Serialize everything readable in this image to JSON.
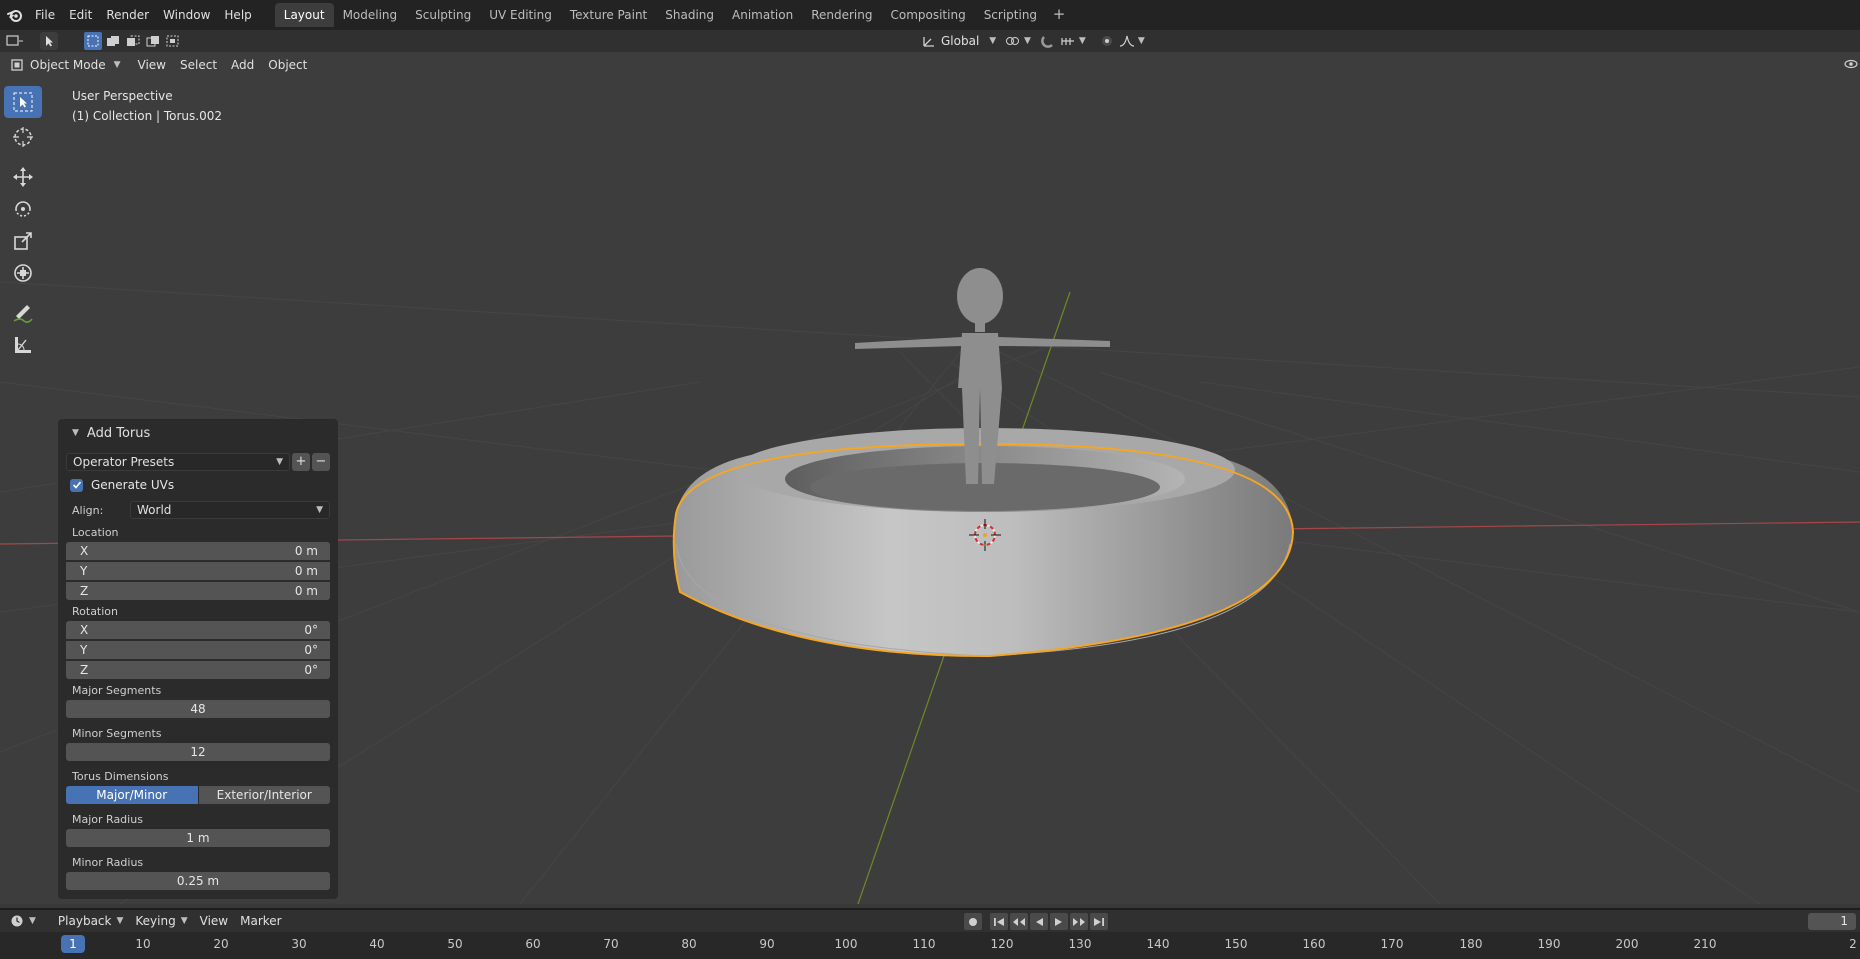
{
  "menubar": {
    "items": [
      "File",
      "Edit",
      "Render",
      "Window",
      "Help"
    ]
  },
  "workspaces": {
    "tabs": [
      "Layout",
      "Modeling",
      "Sculpting",
      "UV Editing",
      "Texture Paint",
      "Shading",
      "Animation",
      "Rendering",
      "Compositing",
      "Scripting"
    ],
    "active": "Layout",
    "add_label": "+"
  },
  "tool_header": {
    "orientation": "Global"
  },
  "viewport_header": {
    "mode": "Object Mode",
    "menus": [
      "View",
      "Select",
      "Add",
      "Object"
    ]
  },
  "viewport": {
    "perspective": "User Perspective",
    "collection_info": "(1) Collection | Torus.002"
  },
  "operator_panel": {
    "title": "Add Torus",
    "presets": "Operator Presets",
    "generate_uvs_label": "Generate UVs",
    "generate_uvs_checked": true,
    "align_label": "Align:",
    "align_value": "World",
    "location_label": "Location",
    "location": [
      {
        "axis": "X",
        "value": "0 m"
      },
      {
        "axis": "Y",
        "value": "0 m"
      },
      {
        "axis": "Z",
        "value": "0 m"
      }
    ],
    "rotation_label": "Rotation",
    "rotation": [
      {
        "axis": "X",
        "value": "0°"
      },
      {
        "axis": "Y",
        "value": "0°"
      },
      {
        "axis": "Z",
        "value": "0°"
      }
    ],
    "major_segments_label": "Major Segments",
    "major_segments": "48",
    "minor_segments_label": "Minor Segments",
    "minor_segments": "12",
    "torus_dimensions_label": "Torus Dimensions",
    "dim_mode_a": "Major/Minor",
    "dim_mode_b": "Exterior/Interior",
    "major_radius_label": "Major Radius",
    "major_radius": "1 m",
    "minor_radius_label": "Minor Radius",
    "minor_radius": "0.25 m"
  },
  "timeline": {
    "menus": [
      "Playback",
      "Keying",
      "View",
      "Marker"
    ],
    "current_frame": "1",
    "frame_field": "1",
    "ticks": [
      "10",
      "20",
      "30",
      "40",
      "50",
      "60",
      "70",
      "80",
      "90",
      "100",
      "110",
      "120",
      "130",
      "140",
      "150",
      "160",
      "170",
      "180",
      "190",
      "200",
      "210",
      "2"
    ]
  },
  "colors": {
    "accent": "#4772b3",
    "selection_outline": "#f5a623",
    "x_axis": "#a3474a",
    "y_axis": "#6c8a25"
  }
}
